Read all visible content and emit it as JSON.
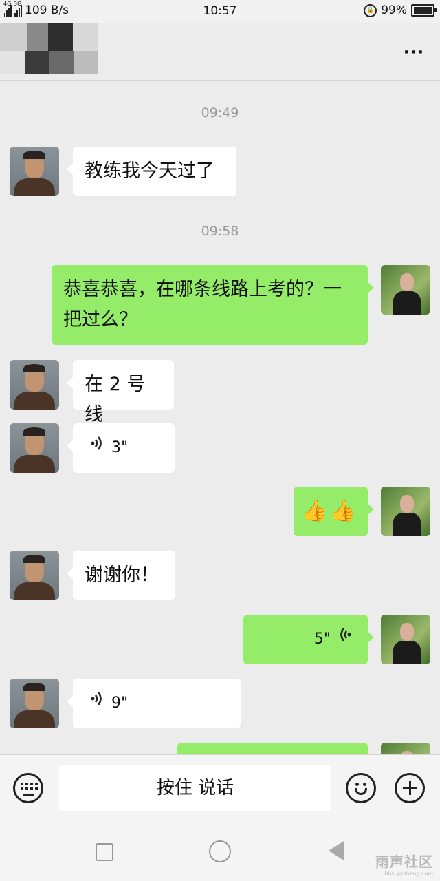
{
  "status_bar": {
    "network_1": "4G",
    "network_2": "3G",
    "speed": "109 B/s",
    "time": "10:57",
    "battery": "99%",
    "battery_level": 0.99
  },
  "header": {
    "more_label": "···"
  },
  "messages": [
    {
      "kind": "timestamp",
      "text": "09:49"
    },
    {
      "kind": "text",
      "from": "contact",
      "text": "教练我今天过了"
    },
    {
      "kind": "timestamp",
      "text": "09:58"
    },
    {
      "kind": "text",
      "from": "me",
      "line1": "恭喜恭喜，在哪条线路上考的？一",
      "line2": "把过么？"
    },
    {
      "kind": "text",
      "from": "contact",
      "text": "在 2 号线"
    },
    {
      "kind": "voice",
      "from": "contact",
      "duration": "3\""
    },
    {
      "kind": "emoji",
      "from": "me",
      "text": "👍👍"
    },
    {
      "kind": "text",
      "from": "contact",
      "text": "谢谢你！"
    },
    {
      "kind": "voice",
      "from": "me",
      "duration": "5\""
    },
    {
      "kind": "voice",
      "from": "contact",
      "duration": "9\""
    }
  ],
  "input_bar": {
    "hold_to_talk": "按住 说话"
  },
  "watermark": {
    "title": "雨声社区",
    "subtitle": "bbs.yusheng.com"
  },
  "colors": {
    "incoming_bubble": "#ffffff",
    "outgoing_bubble": "#95ec69",
    "chat_background": "#ececec"
  }
}
